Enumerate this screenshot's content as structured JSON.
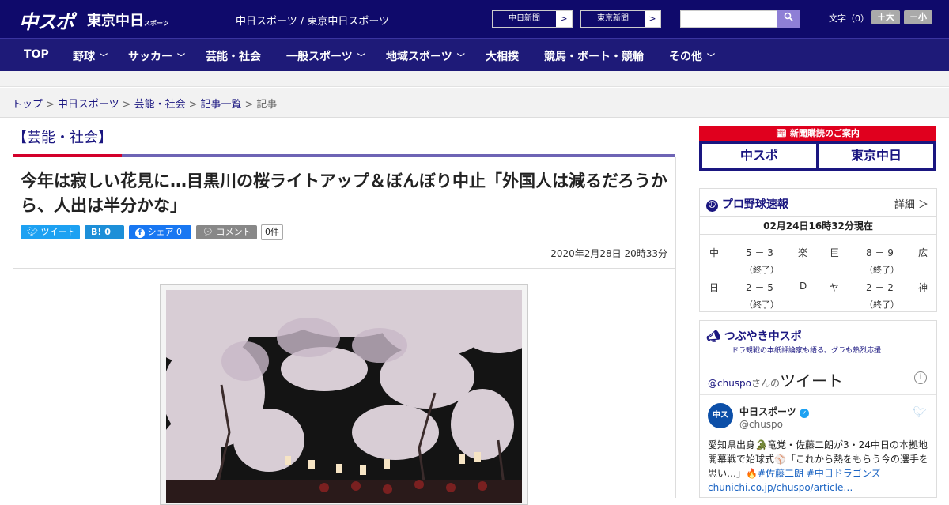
{
  "header": {
    "logo_chunichi": "中スポ",
    "logo_tokyo": "東京中日",
    "logo_tokyo_small": "スポーツ",
    "site_name": "中日スポーツ / 東京中日スポーツ",
    "ext_buttons": [
      "中日新聞",
      "東京新聞"
    ],
    "search_icon": "search-icon",
    "font_size_label": "文字（0）",
    "font_larger": "＋大",
    "font_smaller": "－小"
  },
  "nav": {
    "items": [
      {
        "label": "TOP",
        "dropdown": false
      },
      {
        "label": "野球",
        "dropdown": true
      },
      {
        "label": "サッカー",
        "dropdown": true
      },
      {
        "label": "芸能・社会",
        "dropdown": false
      },
      {
        "label": "一般スポーツ",
        "dropdown": true
      },
      {
        "label": "地域スポーツ",
        "dropdown": true
      },
      {
        "label": "大相撲",
        "dropdown": false
      },
      {
        "label": "競馬・ボート・競輪",
        "dropdown": false
      },
      {
        "label": "その他",
        "dropdown": true
      }
    ]
  },
  "breadcrumb": [
    "トップ",
    "中日スポーツ",
    "芸能・社会",
    "記事一覧",
    "記事"
  ],
  "article": {
    "category": "【芸能・社会】",
    "headline": "今年は寂しい花見に…目黒川の桜ライトアップ＆ぼんぼり中止「外国人は減るだろうから、人出は半分かな」",
    "share": {
      "tweet": "ツイート",
      "hatena": "B! 0",
      "facebook": "シェア 0",
      "comment": "コメント",
      "comment_count": "0件"
    },
    "date": "2020年2月28日 20時33分"
  },
  "sidebar": {
    "subscribe": {
      "header": "新聞購読のご案内",
      "papers": [
        "中スポ",
        "東京中日"
      ]
    },
    "baseball": {
      "title": "プロ野球速報",
      "detail": "詳細 ＞",
      "date": "02月24日16時32分現在",
      "games": [
        {
          "home": "中",
          "score": "5 － 3",
          "status": "（終了）",
          "away": "楽"
        },
        {
          "home": "巨",
          "score": "8 － 9",
          "status": "（終了）",
          "away": "広"
        },
        {
          "home": "日",
          "score": "2 － 5",
          "status": "（終了）",
          "away": "D"
        },
        {
          "home": "ヤ",
          "score": "2 － 2",
          "status": "（終了）",
          "away": "神"
        }
      ]
    },
    "tsubuyaki": {
      "title": "つぶやき中スポ",
      "subtitle": "ドラ観戦の本紙評論家も語る。グラも熱烈応援",
      "handle_prefix": "@chuspo",
      "handle_suffix": "さんの",
      "tweets_label": "ツイート",
      "tweet": {
        "name": "中日スポーツ",
        "handle": "@chuspo",
        "text1": "愛知県出身🐊竜党・佐藤二朗が3・24中日の本拠地開幕戦で始球式⚾「これから熱をもらう今の選手を思い…」🔥",
        "hashtags": "#佐藤二朗 #中日ドラゴンズ",
        "link": "chunichi.co.jp/chuspo/article…"
      }
    }
  }
}
